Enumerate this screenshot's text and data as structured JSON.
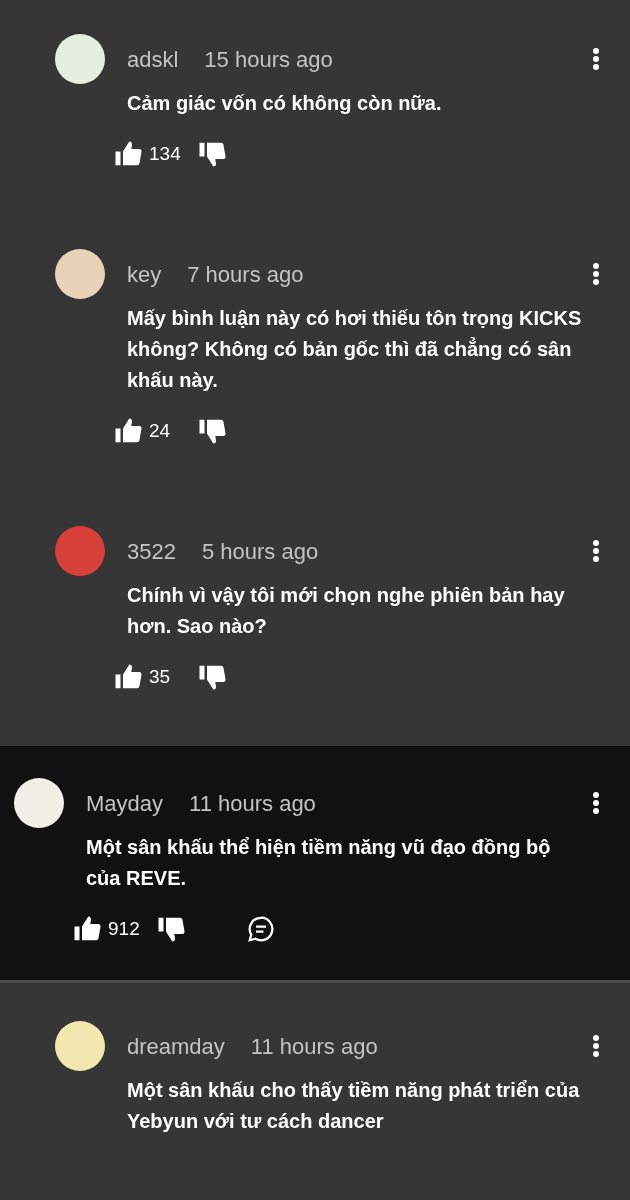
{
  "comments": [
    {
      "author": "adskl",
      "time": "15 hours ago",
      "text": "Cảm giác vốn có không còn nữa.",
      "likes": "134",
      "highlighted": false,
      "reply_button": false
    },
    {
      "author": "key",
      "time": "7 hours ago",
      "text": "Mấy bình luận này có hơi thiếu tôn trọng KICKS không? Không có bản gốc thì đã chẳng có sân khấu này.",
      "likes": "24",
      "highlighted": false,
      "reply_button": false
    },
    {
      "author": "3522",
      "time": "5 hours ago",
      "text": "Chính vì vậy tôi mới chọn nghe phiên bản hay hơn. Sao nào?",
      "likes": "35",
      "highlighted": false,
      "reply_button": false
    },
    {
      "author": "Mayday",
      "time": "11 hours ago",
      "text": "Một sân khấu thể hiện tiềm năng vũ đạo đồng bộ của REVE.",
      "likes": "912",
      "highlighted": true,
      "reply_button": true
    },
    {
      "author": "dreamday",
      "time": "11 hours ago",
      "text": "Một sân khấu cho thấy tiềm năng phát triển của Yebyun với tư cách dancer",
      "highlighted": false
    }
  ]
}
